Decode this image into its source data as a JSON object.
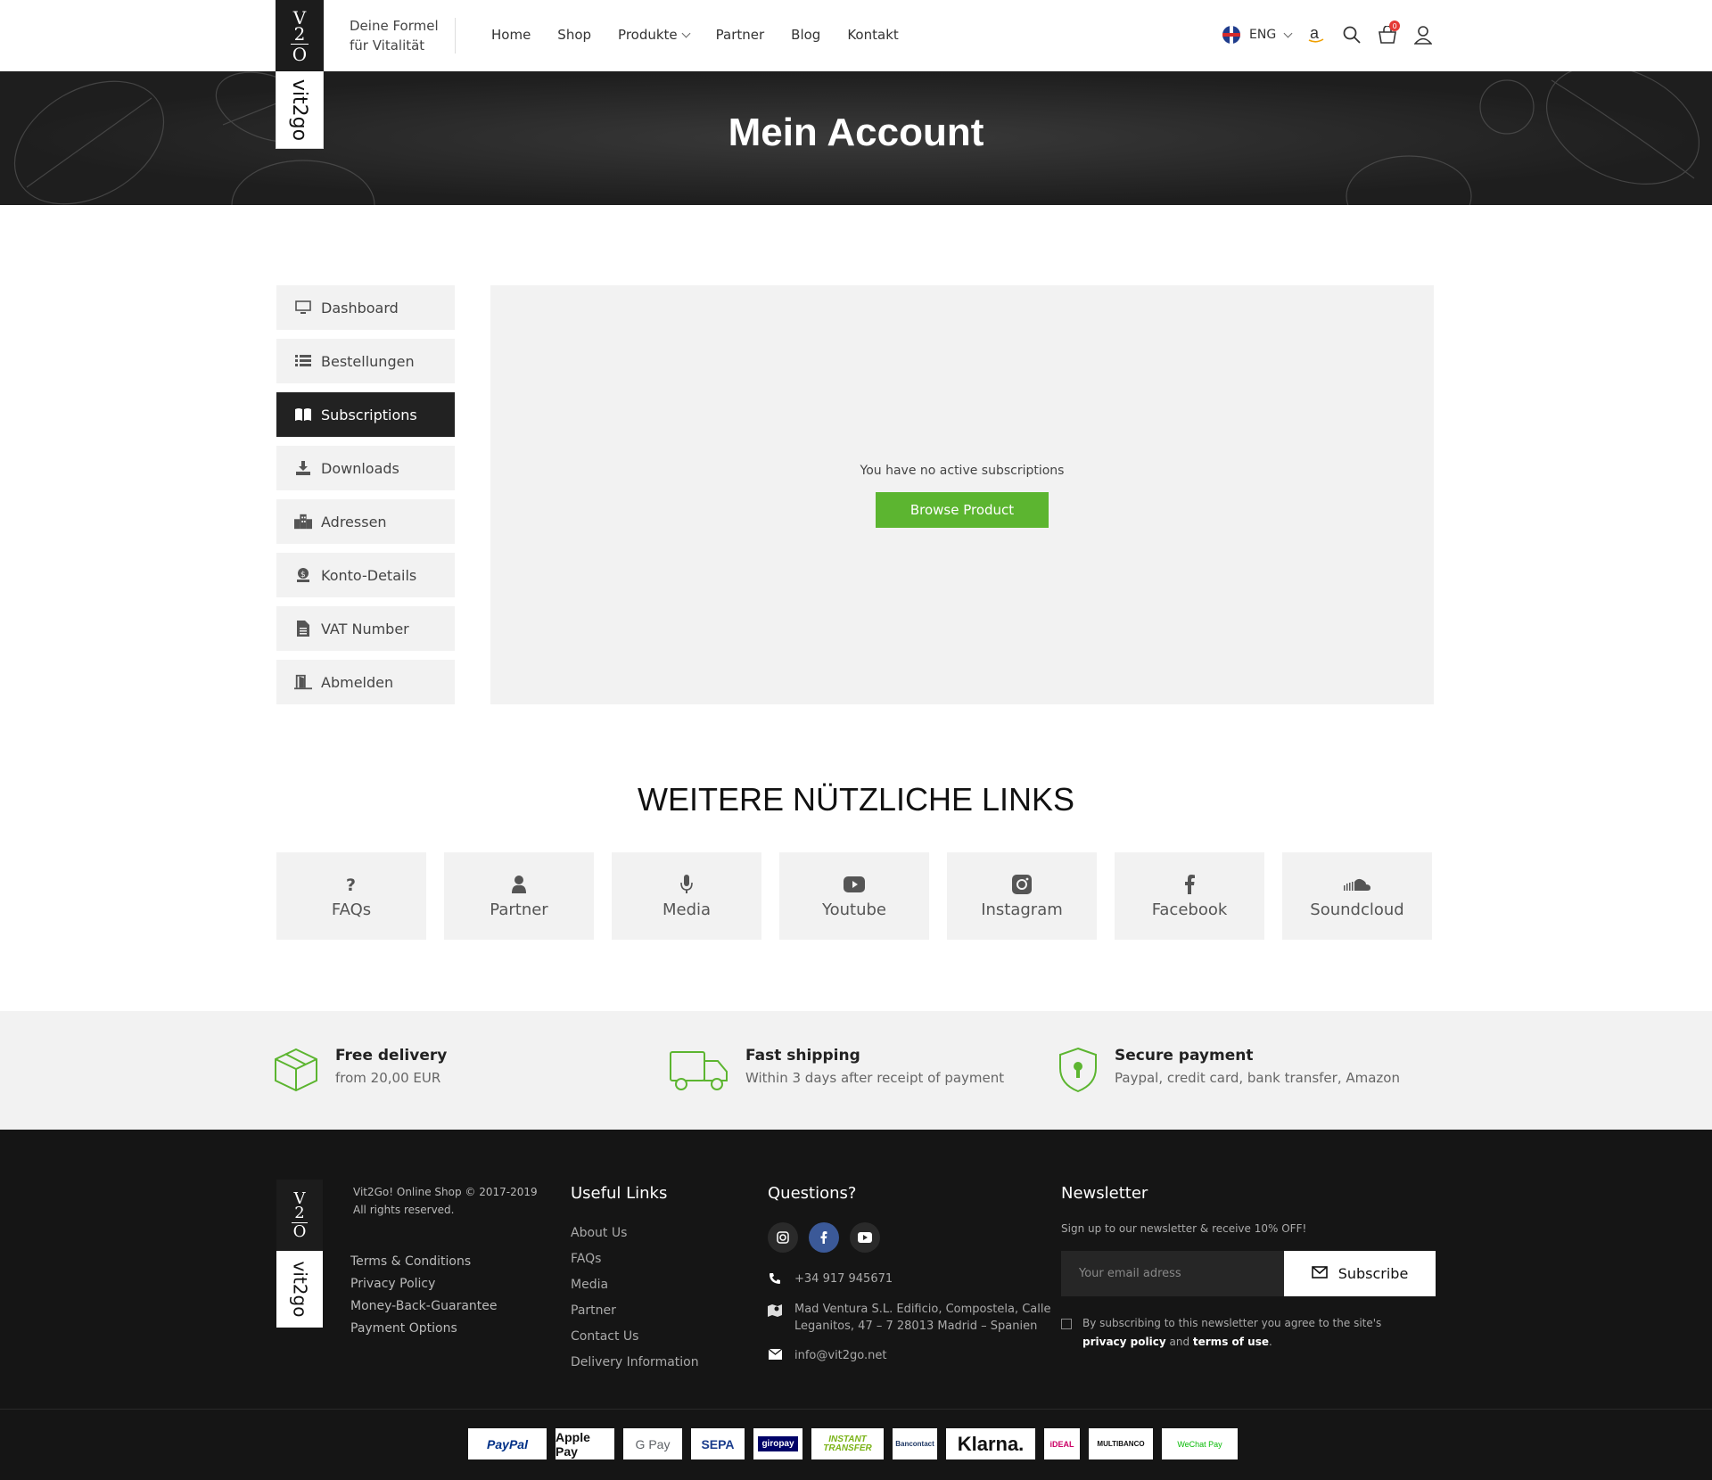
{
  "header": {
    "logo_top": [
      "V",
      "2",
      "O"
    ],
    "logo_bottom": "vit2go",
    "tagline_line1": "Deine Formel",
    "tagline_line2": "für Vitalität",
    "nav": [
      "Home",
      "Shop",
      "Produkte",
      "Partner",
      "Blog",
      "Kontakt"
    ],
    "language": "ENG",
    "cart_count": "0"
  },
  "hero": {
    "title": "Mein Account"
  },
  "sidebar": {
    "items": [
      {
        "label": "Dashboard",
        "icon": "monitor-icon"
      },
      {
        "label": "Bestellungen",
        "icon": "list-icon"
      },
      {
        "label": "Subscriptions",
        "icon": "book-icon",
        "active": true
      },
      {
        "label": "Downloads",
        "icon": "download-icon"
      },
      {
        "label": "Adressen",
        "icon": "building-icon"
      },
      {
        "label": "Konto-Details",
        "icon": "user-coin-icon"
      },
      {
        "label": "VAT Number",
        "icon": "document-icon"
      },
      {
        "label": "Abmelden",
        "icon": "door-exit-icon"
      }
    ]
  },
  "main": {
    "message": "You have no active subscriptions",
    "button": "Browse Product",
    "button_color": "#5cb530"
  },
  "useful_links": {
    "title": "WEITERE NÜTZLICHE LINKS",
    "tiles": [
      {
        "label": "FAQs",
        "icon": "question-icon"
      },
      {
        "label": "Partner",
        "icon": "user-icon"
      },
      {
        "label": "Media",
        "icon": "microphone-icon"
      },
      {
        "label": "Youtube",
        "icon": "youtube-icon"
      },
      {
        "label": "Instagram",
        "icon": "instagram-icon"
      },
      {
        "label": "Facebook",
        "icon": "facebook-icon"
      },
      {
        "label": "Soundcloud",
        "icon": "soundcloud-icon"
      }
    ]
  },
  "features": [
    {
      "title": "Free delivery",
      "subtitle": "from 20,00 EUR",
      "icon": "box-icon"
    },
    {
      "title": "Fast shipping",
      "subtitle": "Within 3 days after receipt of payment",
      "icon": "truck-icon"
    },
    {
      "title": "Secure payment",
      "subtitle": "Paypal, credit card, bank transfer, Amazon",
      "icon": "shield-lock-icon"
    }
  ],
  "footer": {
    "copyright_line1": "Vit2Go! Online Shop © 2017-2019",
    "copyright_line2": "All rights reserved.",
    "legal_links": [
      "Terms & Conditions",
      "Privacy Policy",
      "Money-Back-Guarantee",
      "Payment Options"
    ],
    "useful_title": "Useful Links",
    "useful_links": [
      "About Us",
      "FAQs",
      "Media",
      "Partner",
      "Contact Us",
      "Delivery Information"
    ],
    "questions_title": "Questions?",
    "phone": "+34 917 945671",
    "address_line1": "Mad Ventura S.L. Edificio, Compostela, Calle",
    "address_line2": "Leganitos, 47 – 7 28013 Madrid – Spanien",
    "email": "info@vit2go.net",
    "newsletter_title": "Newsletter",
    "newsletter_text": "Sign up to our newsletter & receive 10% OFF!",
    "email_placeholder": "Your email adress",
    "subscribe": "Subscribe",
    "consent_prefix": "By subscribing to this newsletter you agree to the site's",
    "consent_privacy": "privacy policy",
    "consent_and": "and",
    "consent_terms": "terms of use",
    "consent_end": "."
  },
  "payments": [
    "PayPal",
    "Apple Pay",
    "G Pay",
    "SEPA",
    "giropay",
    "INSTANT TRANSFER",
    "Bancontact",
    "Klarna.",
    "iDEAL",
    "MULTIBANCO",
    "WeChat Pay"
  ]
}
